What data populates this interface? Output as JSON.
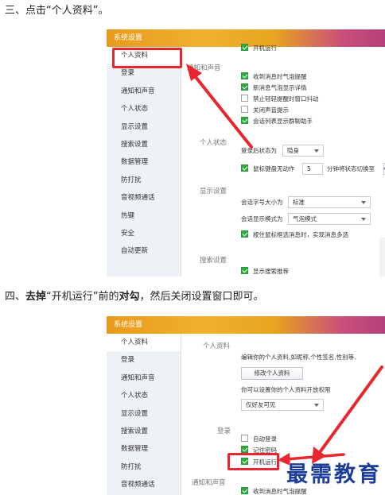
{
  "step3": {
    "prefix": "三、点击",
    "quote": "“个人资料”",
    "suffix": "。"
  },
  "step4": {
    "prefix": "四、",
    "bold1": "去掉",
    "quote": "“开机运行”",
    "middle": "前的",
    "bold2": "对勾",
    "suffix": "，然后关闭设置窗口即可。"
  },
  "window": {
    "title": "系统设置"
  },
  "sidebar": {
    "items": [
      "个人资料",
      "登录",
      "通知和声音",
      "个人状态",
      "显示设置",
      "搜索设置",
      "数据管理",
      "防打扰",
      "音视频通话",
      "热键",
      "安全",
      "自动更新"
    ],
    "active_index": 0
  },
  "shot1": {
    "top_partial": "开机运行",
    "notify_label": "通知和声音",
    "notify_items": [
      {
        "label": "收到消息时气泡提醒",
        "checked": true
      },
      {
        "label": "新消息气泡显示详情",
        "checked": true
      },
      {
        "label": "禁止轻轻提醒时窗口抖动",
        "checked": false
      },
      {
        "label": "关闭声音提示",
        "checked": false
      },
      {
        "label": "会话列表显示群聊助手",
        "checked": true
      }
    ],
    "status_label": "个人状态",
    "login_status_label": "登录后状态为",
    "login_status_value": "隐身",
    "idle_label": "鼠标键盘无动作",
    "idle_value": "5",
    "idle_suffix": "分钟将状态切换至",
    "display_label": "显示设置",
    "font_label": "会话字号大小为",
    "font_value": "标准",
    "mode_label": "会话显示模式为",
    "mode_value": "气泡模式",
    "hover_label": "按住鼠标框选消息时，实现消息多选",
    "hover_checked": true,
    "search_label": "搜索设置",
    "search_item": "显示搜索推荐",
    "search_checked": true
  },
  "shot2": {
    "profile_label": "个人资料",
    "profile_desc": "编辑你的个人资料,如昵称,个性签名,性别等.",
    "edit_button": "修改个人资料",
    "privacy_desc": "你可以设置你的个人资料开放权限",
    "privacy_value": "仅好友可见",
    "login_label": "登录",
    "login_items": [
      {
        "label": "自动登录",
        "checked": false
      },
      {
        "label": "记住密码",
        "checked": true
      },
      {
        "label": "开机运行",
        "checked": true
      }
    ],
    "notify_label": "通知和声音",
    "notify_first": "收到消息时气泡提醒",
    "notify_first_checked": true
  },
  "watermark": "最需教育",
  "colors": {
    "highlight": "#e8262f",
    "checkbox": "#2faa3f",
    "watermark": "#1d3c9a"
  }
}
